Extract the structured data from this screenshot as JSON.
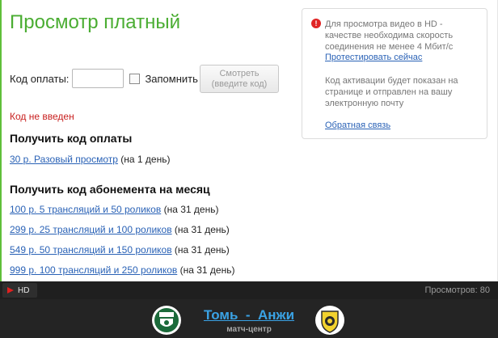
{
  "title": "Просмотр платный",
  "code_label": "Код оплаты:",
  "remember_label": "Запомнить",
  "watch_button": {
    "line1": "Смотреть",
    "line2": "(введите код)"
  },
  "error": "Код не введен",
  "single_section": "Получить код оплаты",
  "single_offer": {
    "link": "30 р. Разовый просмотр",
    "period": "(на 1 день)"
  },
  "subscription_section": "Получить код абонемента на месяц",
  "subscriptions": [
    {
      "link": "100 р. 5 трансляций и 50 роликов",
      "period": "(на 31 день)"
    },
    {
      "link": "299 р. 25 трансляций и 100 роликов",
      "period": "(на 31 день)"
    },
    {
      "link": "549 р. 50 трансляций и 150 роликов",
      "period": "(на 31 день)"
    },
    {
      "link": "999 р. 100 трансляций и 250 роликов",
      "period": "(на 31 день)"
    }
  ],
  "info": {
    "hd_line1": "Для просмотра видео в HD -",
    "hd_line2": "качестве необходима скорость",
    "hd_line3": "соединения не менее 4 Мбит/с",
    "speed_test_link": "Протестировать сейчас",
    "code_line1": "Код активации будет показан на",
    "code_line2": "странице и отправлен на вашу",
    "code_line3": "электронную почту",
    "feedback_link": "Обратная связь",
    "icon_glyph": "!"
  },
  "player": {
    "hd_label": "HD",
    "views": "Просмотров: 80"
  },
  "match": {
    "title": "Томь  -  Анжи",
    "subtitle": "матч-центр"
  },
  "colors": {
    "accent": "#4aad32",
    "link": "#2a62b6",
    "error": "#c8201f",
    "match_link": "#3aa2e4"
  },
  "icons": {
    "play": "play-icon",
    "info": "warning-icon",
    "home_badge": "tom-club-badge",
    "away_badge": "anzhi-club-badge"
  }
}
